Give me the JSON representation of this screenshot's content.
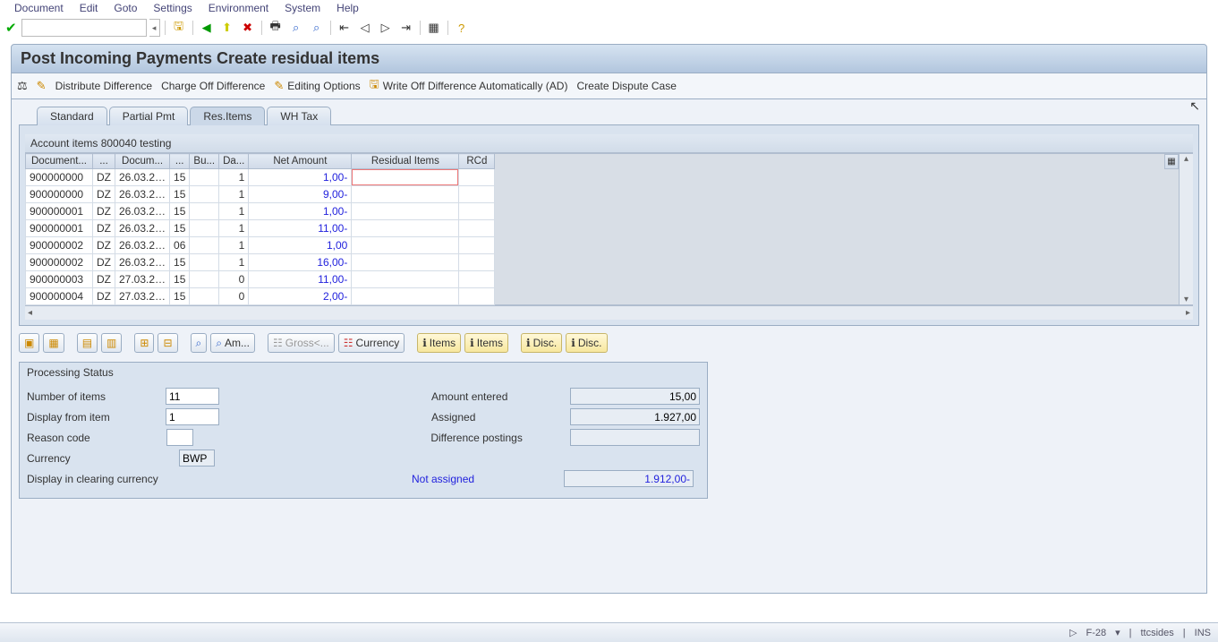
{
  "menu": [
    "Document",
    "Edit",
    "Goto",
    "Settings",
    "Environment",
    "System",
    "Help"
  ],
  "page_title": "Post Incoming Payments Create residual items",
  "app_toolbar": [
    {
      "icon": "⚖",
      "label": "Distribute Difference"
    },
    {
      "icon": "",
      "label": "Charge Off Difference"
    },
    {
      "icon": "✎",
      "label": "Editing Options"
    },
    {
      "icon": "🖫",
      "label": "Write Off Difference Automatically (AD)"
    },
    {
      "icon": "",
      "label": "Create Dispute Case"
    }
  ],
  "tabs": [
    {
      "label": "Standard",
      "active": false
    },
    {
      "label": "Partial Pmt",
      "active": false
    },
    {
      "label": "Res.Items",
      "active": true
    },
    {
      "label": "WH Tax",
      "active": false
    }
  ],
  "grid_caption": "Account items 800040 testing",
  "columns": [
    "Document...",
    "...",
    "Docum...",
    "...",
    "Bu...",
    "Da...",
    "Net Amount",
    "Residual Items",
    "RCd"
  ],
  "rows": [
    {
      "doc": "900000000",
      "c1": "DZ",
      "date": "26.03.2…",
      "c3": "15",
      "bu": "",
      "da": "1",
      "net": "1,00-",
      "res": "",
      "rcd": "",
      "sel": true
    },
    {
      "doc": "900000000",
      "c1": "DZ",
      "date": "26.03.2…",
      "c3": "15",
      "bu": "",
      "da": "1",
      "net": "9,00-",
      "res": "",
      "rcd": ""
    },
    {
      "doc": "900000001",
      "c1": "DZ",
      "date": "26.03.2…",
      "c3": "15",
      "bu": "",
      "da": "1",
      "net": "1,00-",
      "res": "",
      "rcd": ""
    },
    {
      "doc": "900000001",
      "c1": "DZ",
      "date": "26.03.2…",
      "c3": "15",
      "bu": "",
      "da": "1",
      "net": "11,00-",
      "res": "",
      "rcd": ""
    },
    {
      "doc": "900000002",
      "c1": "DZ",
      "date": "26.03.2…",
      "c3": "06",
      "bu": "",
      "da": "1",
      "net": "1,00",
      "res": "",
      "rcd": ""
    },
    {
      "doc": "900000002",
      "c1": "DZ",
      "date": "26.03.2…",
      "c3": "15",
      "bu": "",
      "da": "1",
      "net": "16,00-",
      "res": "",
      "rcd": ""
    },
    {
      "doc": "900000003",
      "c1": "DZ",
      "date": "27.03.2…",
      "c3": "15",
      "bu": "",
      "da": "0",
      "net": "11,00-",
      "res": "",
      "rcd": ""
    },
    {
      "doc": "900000004",
      "c1": "DZ",
      "date": "27.03.2…",
      "c3": "15",
      "bu": "",
      "da": "0",
      "net": "2,00-",
      "res": "",
      "rcd": ""
    }
  ],
  "mini": {
    "am": "Am...",
    "gross": "Gross<...",
    "currency": "Currency",
    "items1": "Items",
    "items2": "Items",
    "disc1": "Disc.",
    "disc2": "Disc."
  },
  "proc": {
    "title": "Processing Status",
    "num_items_label": "Number of items",
    "num_items": "11",
    "display_from_label": "Display from item",
    "display_from": "1",
    "reason_label": "Reason code",
    "reason": "",
    "currency_label": "Currency",
    "currency": "BWP",
    "clearing_label": "Display in clearing currency",
    "amount_entered_label": "Amount entered",
    "amount_entered": "15,00",
    "assigned_label": "Assigned",
    "assigned": "1.927,00",
    "diff_post_label": "Difference postings",
    "diff_post": "",
    "not_assigned_label": "Not assigned",
    "not_assigned": "1.912,00-"
  },
  "status": {
    "tcode": "F-28",
    "sess": "ttcsides",
    "mode": "INS"
  }
}
